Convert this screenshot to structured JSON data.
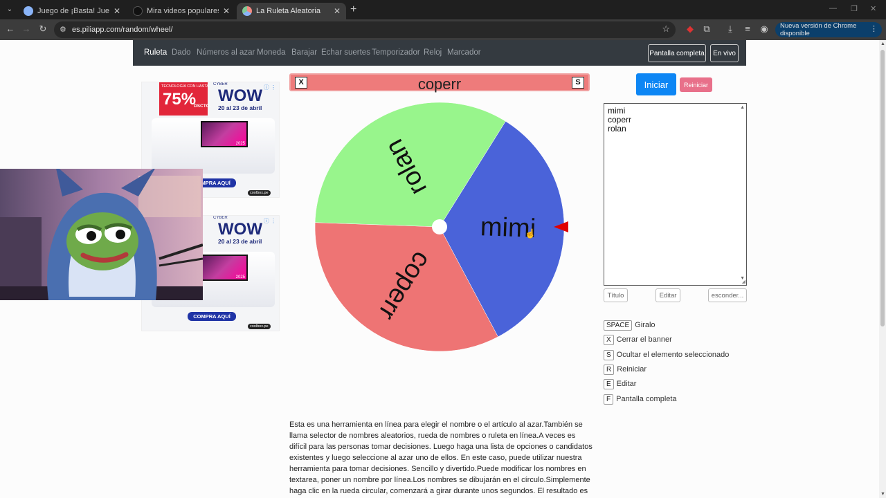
{
  "browser": {
    "tabs": [
      {
        "title": "Juego de ¡Basta! Juega Stop, Tu",
        "favicon_color": "#8ab4f8"
      },
      {
        "title": "Mira videos populares seleccio",
        "favicon_color": "#111111"
      },
      {
        "title": "La Ruleta Aleatoria",
        "favicon_color": "#f28b82"
      }
    ],
    "url": "es.piliapp.com/random/wheel/",
    "update_chip": "Nueva versión de Chrome disponible"
  },
  "nav": {
    "items": [
      "Ruleta",
      "Dado",
      "Números al azar",
      "Moneda",
      "Barajar",
      "Echar suertes",
      "Temporizador",
      "Reloj",
      "Marcador"
    ],
    "fullscreen_label": "Pantalla completa",
    "live_label": "En vivo"
  },
  "ads": [
    {
      "tag": "TECNOLOGÍA CON HASTA",
      "percent": "75%",
      "dscto": "DSCTO.",
      "cyber": "CYBER",
      "wow": "WOW",
      "dates": "20 al 23 de abril",
      "cta": "COMPRA AQUÍ",
      "brand": "coolbox.pe",
      "year": "2025"
    },
    {
      "tag": "",
      "percent": "",
      "dscto": "",
      "cyber": "CYBER",
      "wow": "WOW",
      "dates": "20 al 23 de abril",
      "cta": "COMPRA AQUÍ",
      "brand": "coolbox.pe",
      "year": "2025"
    }
  ],
  "banner": {
    "close_key": "X",
    "hide_key": "S",
    "selected": "coperr"
  },
  "wheel": {
    "segments": [
      {
        "label": "mimi",
        "color": "#4a63d9"
      },
      {
        "label": "coperr",
        "color": "#ee7474"
      },
      {
        "label": "rolan",
        "color": "#98f58c"
      }
    ],
    "pointer_color": "#e00000"
  },
  "controls": {
    "start": "Iniciar",
    "reset": "Reiniciar",
    "names": [
      "mimi",
      "coperr",
      "rolan"
    ],
    "title_btn": "Título",
    "edit_btn": "Editar",
    "hide_btn": "esconder..."
  },
  "shortcuts": [
    {
      "key": "SPACE",
      "label": "Giralo"
    },
    {
      "key": "X",
      "label": "Cerrar el banner"
    },
    {
      "key": "S",
      "label": "Ocultar el elemento seleccionado"
    },
    {
      "key": "R",
      "label": "Reiniciar"
    },
    {
      "key": "E",
      "label": "Editar"
    },
    {
      "key": "F",
      "label": "Pantalla completa"
    }
  ],
  "description": "Esta es una herramienta en línea para elegir el nombre o el artículo al azar.También se llama selector de nombres aleatorios, rueda de nombres o ruleta en línea.A veces es difícil para las personas tomar decisiones. Luego haga una lista de opciones o candidatos existentes y luego seleccione al azar uno de ellos. En este caso, puede utilizar nuestra herramienta para tomar decisiones. Sencillo y divertido.Puede modificar los nombres en textarea, poner un nombre por línea.Los nombres se dibujarán en el círculo.Simplemente haga clic en la rueda circular, comenzará a girar durante unos segundos. El resultado es seleccionar al azar uno"
}
